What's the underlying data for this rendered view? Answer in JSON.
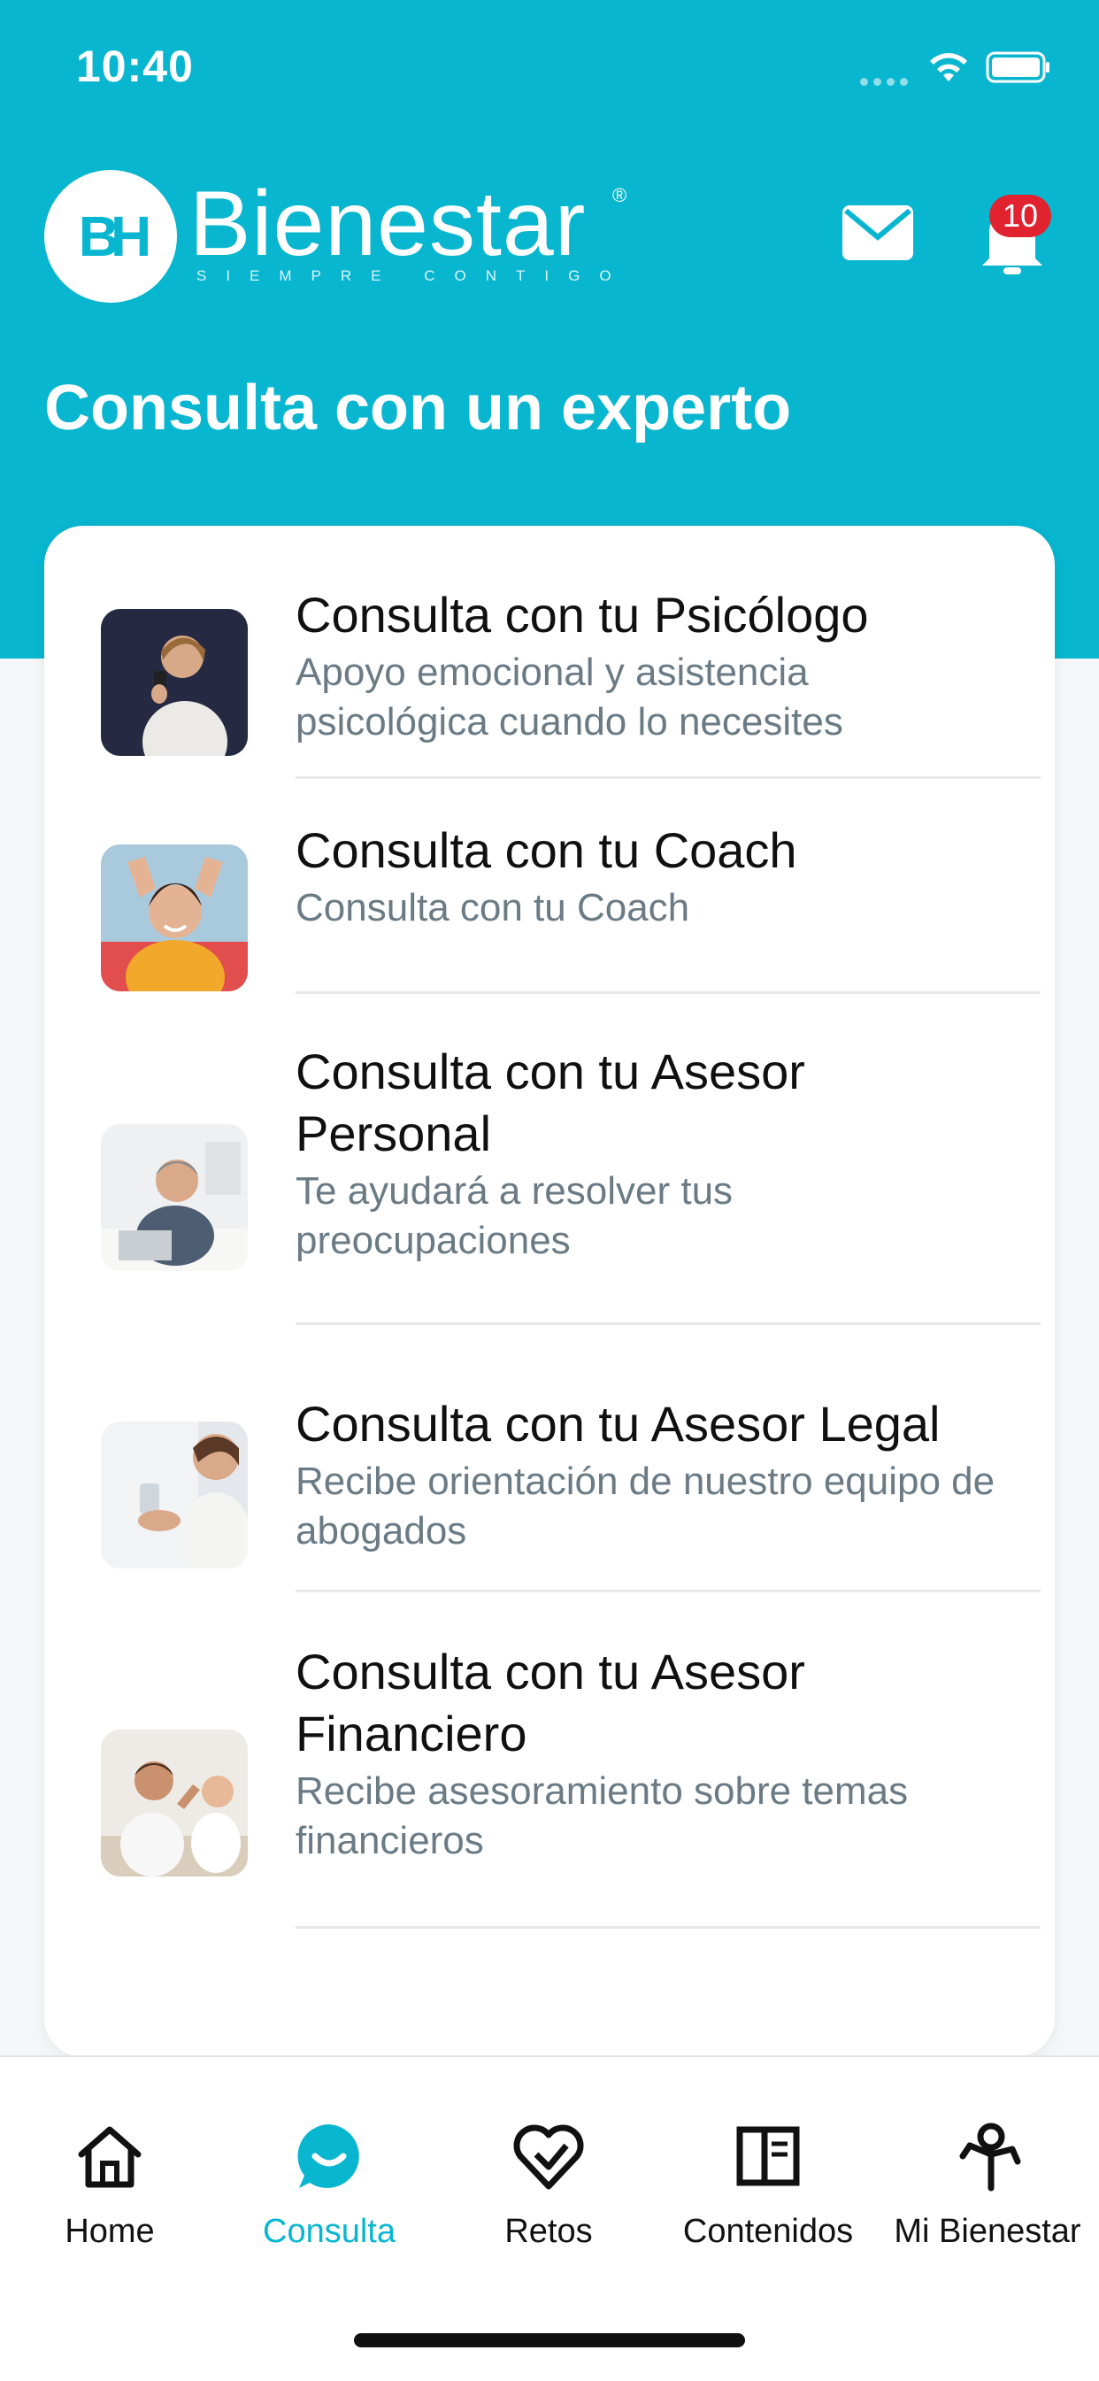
{
  "status_bar": {
    "time": "10:40"
  },
  "header": {
    "brand_mono": "BH",
    "brand_name": "Bienestar",
    "brand_reg": "®",
    "brand_tagline": "SIEMPRE CONTIGO",
    "notification_count": "10",
    "page_title": "Consulta con un experto"
  },
  "items": [
    {
      "title": "Consulta con tu Psicólogo",
      "subtitle": "Apoyo emocional y asistencia psicológica cuando lo necesites"
    },
    {
      "title": "Consulta con tu Coach",
      "subtitle": "Consulta con tu Coach"
    },
    {
      "title": "Consulta con tu Asesor Personal",
      "subtitle": "Te ayudará a resolver tus preocupaciones"
    },
    {
      "title": "Consulta con tu Asesor Legal",
      "subtitle": "Recibe orientación de nuestro equipo de abogados"
    },
    {
      "title": "Consulta con tu Asesor Financiero",
      "subtitle": "Recibe asesoramiento sobre temas financieros"
    }
  ],
  "tabbar": {
    "tabs": [
      {
        "label": "Home",
        "icon": "home-icon"
      },
      {
        "label": "Consulta",
        "icon": "chat-bubble-icon",
        "active": true
      },
      {
        "label": "Retos",
        "icon": "heart-challenge-icon"
      },
      {
        "label": "Contenidos",
        "icon": "book-icon"
      },
      {
        "label": "Mi Bienestar",
        "icon": "person-wellbeing-icon"
      }
    ]
  },
  "colors": {
    "primary": "#08b6cf",
    "badge": "#e0232f",
    "text": "#101010",
    "subtext": "#6b7b86"
  }
}
